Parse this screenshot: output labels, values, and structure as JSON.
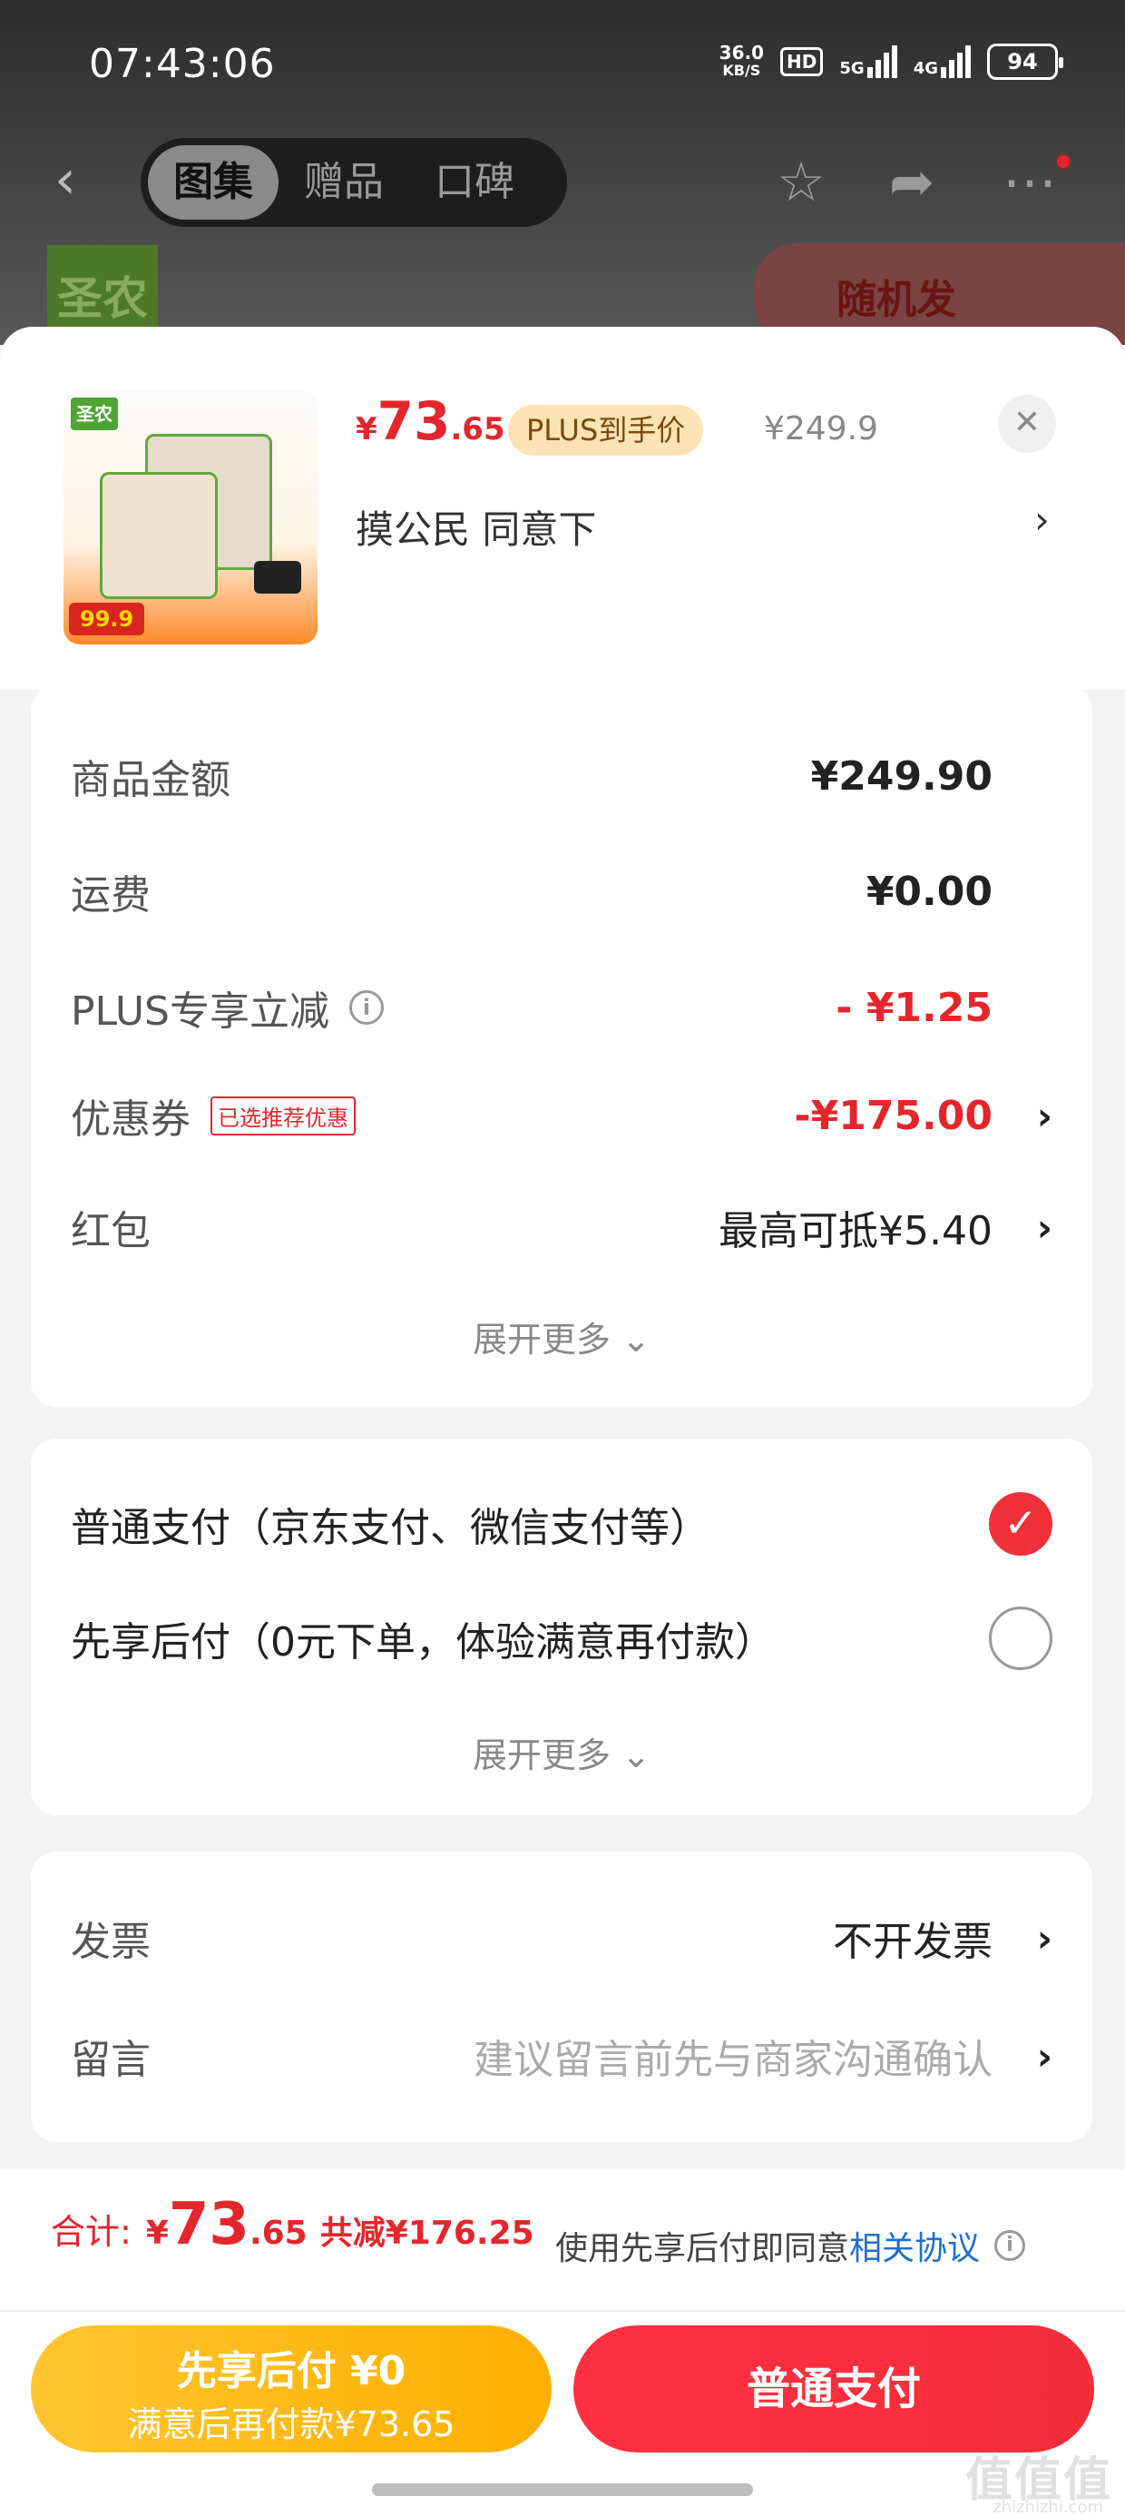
{
  "status": {
    "time": "07:43:06",
    "net_speed_top": "36.0",
    "net_speed_unit": "KB/S",
    "hd": "HD",
    "sig1": "5G",
    "sig2": "4G",
    "battery": "94"
  },
  "nav": {
    "tabs": [
      "图集",
      "赠品",
      "口碑"
    ],
    "active_tab": 0,
    "brand_tile": "圣农",
    "promo": "随机发"
  },
  "product": {
    "price_currency": "¥",
    "price_int": "73",
    "price_dec": ".65",
    "plus_badge": "PLUS到手价",
    "original_price": "¥249.9",
    "spec": "摸公民  同意下",
    "img_logo": "圣农",
    "img_price": "99.9"
  },
  "summary": {
    "rows": [
      {
        "label": "商品金额",
        "value": "¥249.90"
      },
      {
        "label": "运费",
        "value": "¥0.00"
      },
      {
        "label": "PLUS专享立减",
        "value": "- ¥1.25"
      },
      {
        "label": "优惠券",
        "tag": "已选推荐优惠",
        "value": "-¥175.00"
      },
      {
        "label": "红包",
        "value": "最高可抵¥5.40"
      }
    ],
    "more": "展开更多"
  },
  "payment": {
    "options": [
      {
        "label": "普通支付（京东支付、微信支付等）",
        "selected": true
      },
      {
        "label": "先享后付（0元下单，体验满意再付款）",
        "selected": false
      }
    ],
    "more": "展开更多"
  },
  "extra": {
    "invoice_label": "发票",
    "invoice_value": "不开发票",
    "message_label": "留言",
    "message_placeholder": "建议留言前先与商家沟通确认"
  },
  "footer": {
    "total_label": "合计:",
    "total_currency": "¥",
    "total_int": "73",
    "total_dec": ".65",
    "discount": "共减¥176.25",
    "agree_text": "使用先享后付即同意",
    "agree_link": "相关协议",
    "btn_later_title": "先享后付 ¥0",
    "btn_later_sub": "满意后再付款¥73.65",
    "btn_pay": "普通支付"
  },
  "watermark": {
    "main": "值值值",
    "sub": "zhizhizhi.com"
  },
  "colors": {
    "accent_red": "#e4262c",
    "pay_yellow": "#ffb000",
    "link_blue": "#1f6fd1"
  }
}
